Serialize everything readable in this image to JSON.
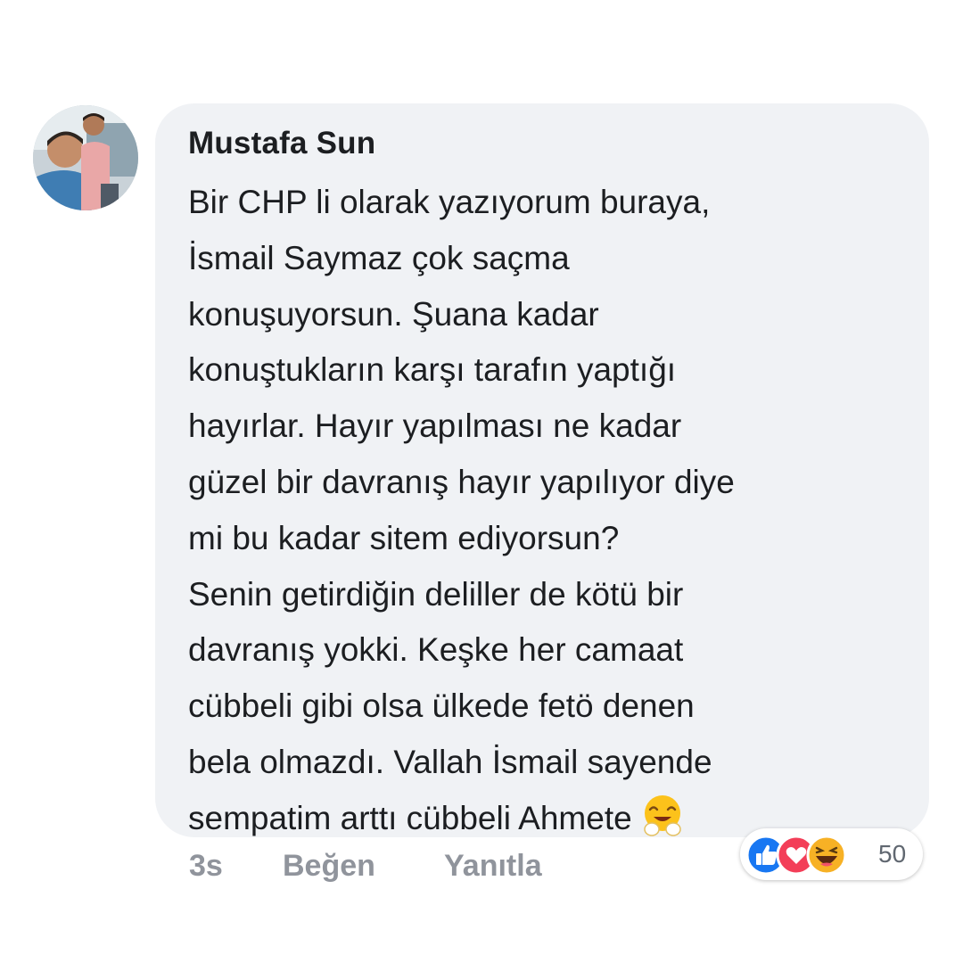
{
  "comment": {
    "author": "Mustafa Sun",
    "lines": [
      "Bir CHP li olarak yazıyorum buraya,",
      "İsmail Saymaz çok saçma",
      "konuşuyorsun. Şuana kadar",
      "konuştukların karşı tarafın yaptığı",
      "hayırlar. Hayır yapılması ne kadar",
      "güzel bir davranış hayır yapılıyor diye",
      "mi bu kadar sitem ediyorsun?",
      "Senin getirdiğin deliller de kötü bir",
      "davranış yokki. Keşke her camaat",
      "cübbeli gibi olsa ülkede fetö denen",
      "bela olmazdı. Vallah İsmail sayende",
      "sempatim arttı cübbeli Ahmete"
    ],
    "trailing_emoji": "smiling-face-with-open-hands"
  },
  "actions": {
    "time": "3s",
    "like_label": "Beğen",
    "reply_label": "Yanıtla"
  },
  "reactions": {
    "icons": [
      "like-icon",
      "love-icon",
      "haha-icon"
    ],
    "count": "50",
    "colors": {
      "like": "#1877f2",
      "love": "#f33e58",
      "haha": "#f7b125"
    }
  },
  "colors": {
    "bubble_background": "#f0f2f5",
    "text": "#1c1e21",
    "action_text": "#90949c"
  }
}
